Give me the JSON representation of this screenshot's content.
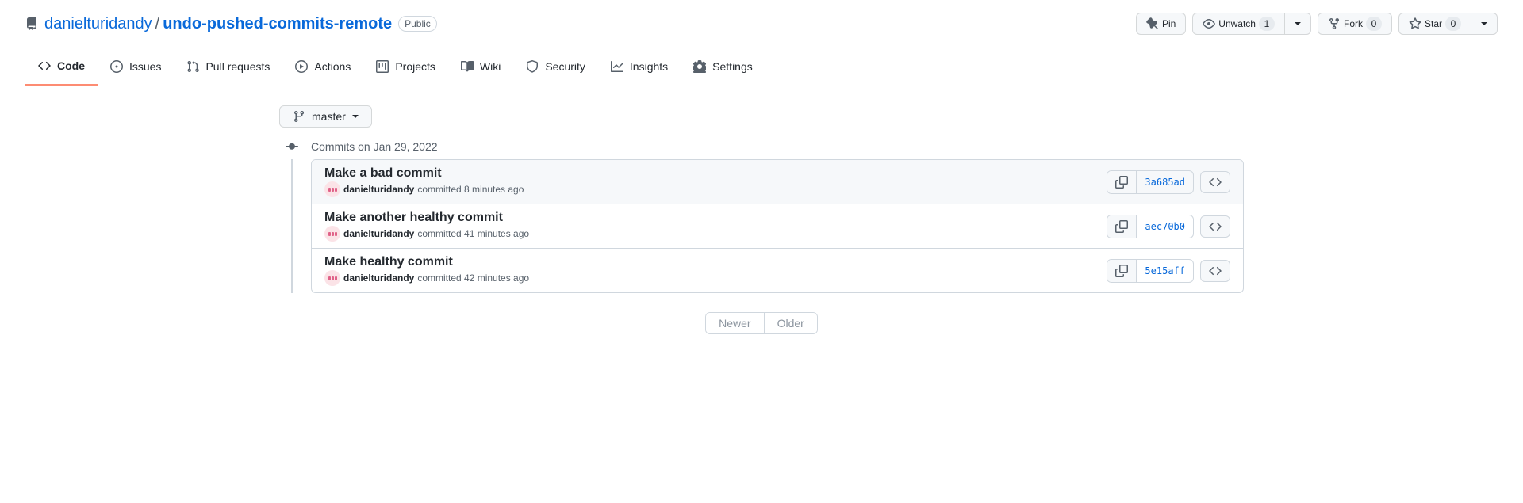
{
  "repo": {
    "owner": "danielturidandy",
    "name": "undo-pushed-commits-remote",
    "visibility": "Public"
  },
  "actions": {
    "pin": "Pin",
    "unwatch": "Unwatch",
    "unwatch_count": "1",
    "fork": "Fork",
    "fork_count": "0",
    "star": "Star",
    "star_count": "0"
  },
  "nav": {
    "code": "Code",
    "issues": "Issues",
    "pulls": "Pull requests",
    "actions": "Actions",
    "projects": "Projects",
    "wiki": "Wiki",
    "security": "Security",
    "insights": "Insights",
    "settings": "Settings"
  },
  "branch": "master",
  "timeline_label": "Commits on Jan 29, 2022",
  "commits": [
    {
      "title": "Make a bad commit",
      "author": "danielturidandy",
      "meta": "committed 8 minutes ago",
      "sha": "3a685ad"
    },
    {
      "title": "Make another healthy commit",
      "author": "danielturidandy",
      "meta": "committed 41 minutes ago",
      "sha": "aec70b0"
    },
    {
      "title": "Make healthy commit",
      "author": "danielturidandy",
      "meta": "committed 42 minutes ago",
      "sha": "5e15aff"
    }
  ],
  "pagination": {
    "newer": "Newer",
    "older": "Older"
  }
}
